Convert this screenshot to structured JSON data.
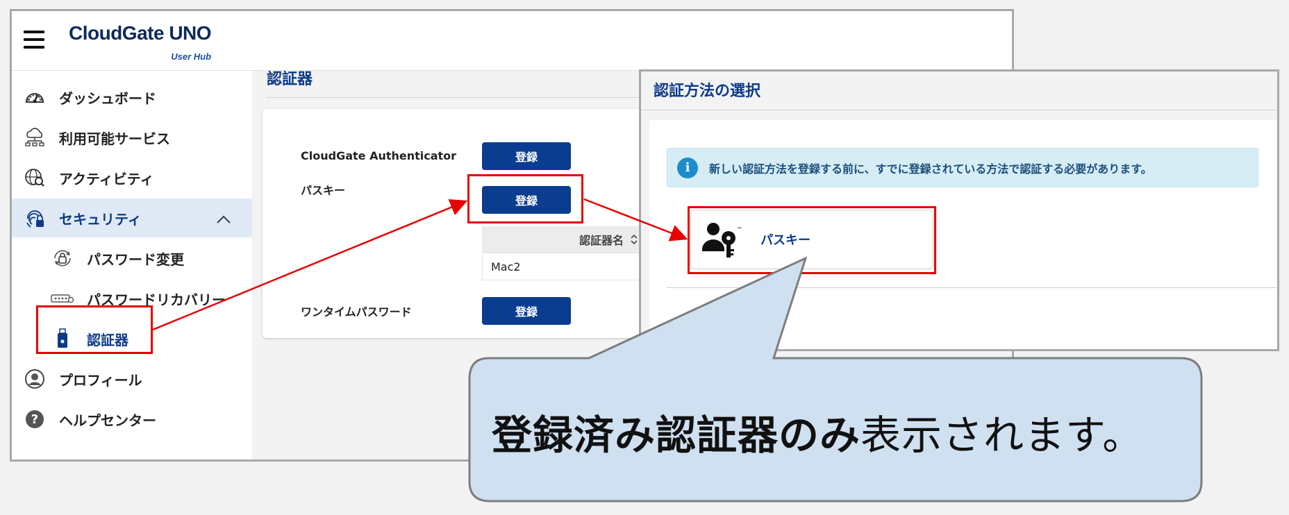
{
  "header": {
    "logo_main": "CloudGate UNO",
    "logo_sub": "User Hub"
  },
  "sidebar": {
    "items": [
      {
        "label": "ダッシュボード",
        "icon": "dashboard-gauge-icon"
      },
      {
        "label": "利用可能サービス",
        "icon": "cloud-network-icon"
      },
      {
        "label": "アクティビティ",
        "icon": "globe-search-icon"
      },
      {
        "label": "セキュリティ",
        "icon": "fingerprint-lock-icon"
      },
      {
        "label": "パスワード変更",
        "icon": "password-lock-icon"
      },
      {
        "label": "パスワードリカバリー",
        "icon": "password-field-icon"
      },
      {
        "label": "認証器",
        "icon": "usb-key-icon"
      },
      {
        "label": "プロフィール",
        "icon": "user-circle-icon"
      },
      {
        "label": "ヘルプセンター",
        "icon": "help-circle-icon"
      }
    ],
    "active": "セキュリティ"
  },
  "main": {
    "section_title": "認証器",
    "rows": [
      {
        "label": "CloudGate Authenticator",
        "button": "登録"
      },
      {
        "label": "パスキー",
        "button": "登録"
      },
      {
        "label": "ワンタイムパスワード",
        "button": "登録"
      }
    ],
    "table": {
      "header": "認証器名",
      "sort_icon": "sort-updown-icon",
      "rows": [
        "Mac2"
      ]
    }
  },
  "dialog": {
    "title": "認証方法の選択",
    "info": "新しい認証方法を登録する前に、すでに登録されている方法で認証する必要があります。",
    "option_label": "パスキー",
    "option_icon": "user-key-icon"
  },
  "callout": {
    "bold": "登録済み認証器のみ",
    "normal": "表示されます。"
  },
  "colors": {
    "accent": "#0a3d8f",
    "highlight": "#e60000",
    "callout_fill": "#cfe0f1",
    "active_nav_bg": "#dfeaf6"
  }
}
